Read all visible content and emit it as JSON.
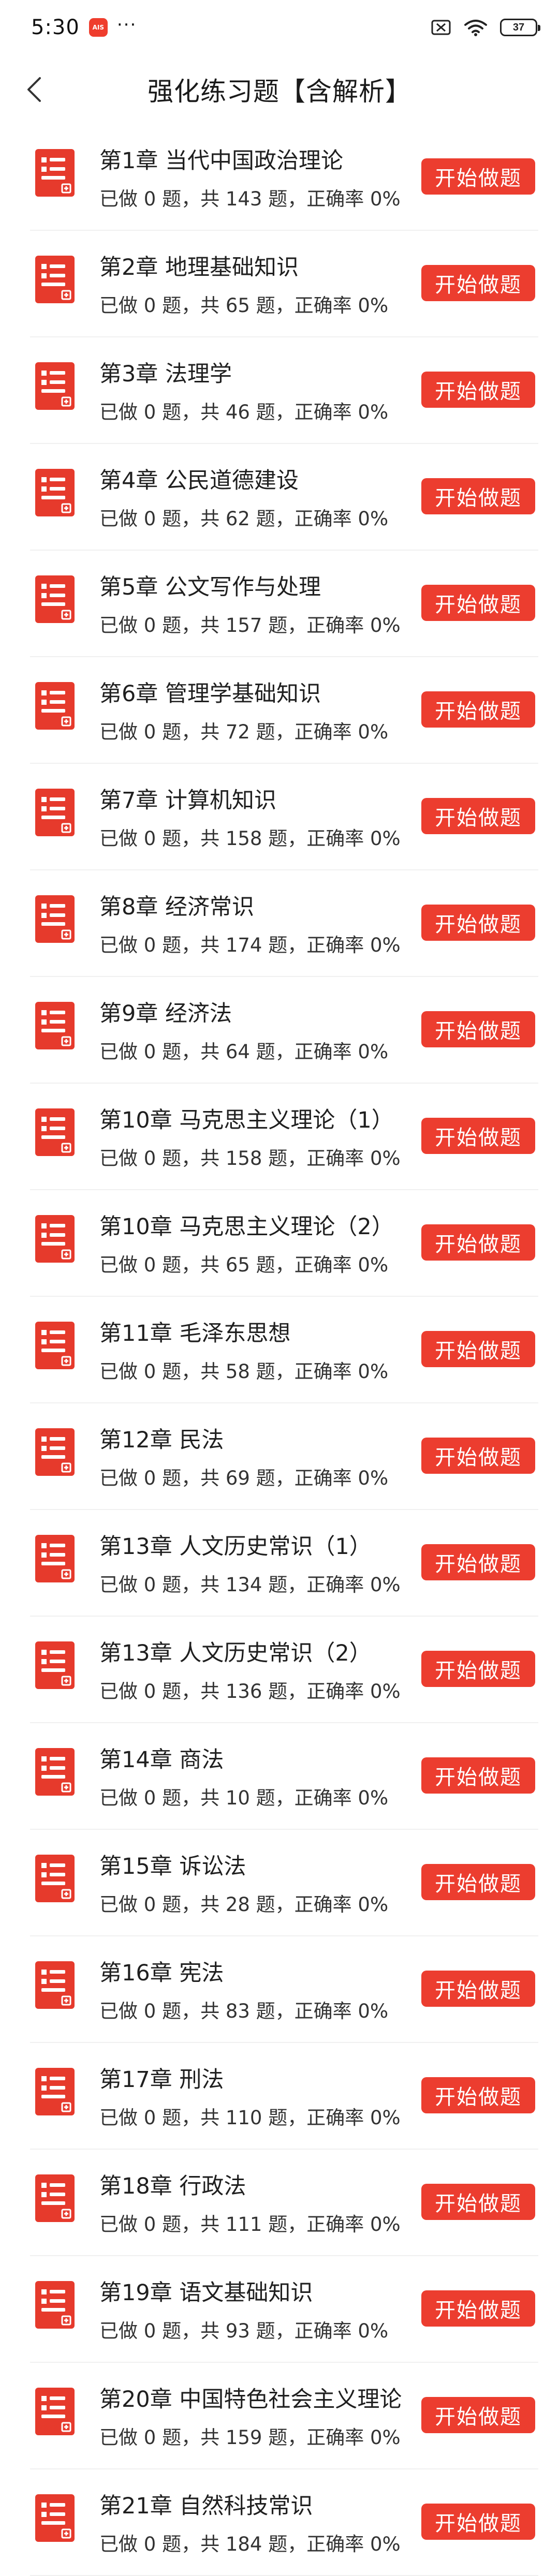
{
  "status_bar": {
    "time": "5:30",
    "app_badge": "AIS",
    "more": "···",
    "battery": "37"
  },
  "header": {
    "title": "强化练习题【含解析】"
  },
  "colors": {
    "accent": "#ec3d2f",
    "divider": "#f0f0f0"
  },
  "chapter_button_label": "开始做题",
  "chapters": [
    {
      "title": "第1章 当代中国政治理论",
      "stats": "已做 0 题，共 143 题，正确率 0%"
    },
    {
      "title": "第2章 地理基础知识",
      "stats": "已做 0 题，共 65 题，正确率 0%"
    },
    {
      "title": "第3章 法理学",
      "stats": "已做 0 题，共 46 题，正确率 0%"
    },
    {
      "title": "第4章 公民道德建设",
      "stats": "已做 0 题，共 62 题，正确率 0%"
    },
    {
      "title": "第5章 公文写作与处理",
      "stats": "已做 0 题，共 157 题，正确率 0%"
    },
    {
      "title": "第6章 管理学基础知识",
      "stats": "已做 0 题，共 72 题，正确率 0%"
    },
    {
      "title": "第7章 计算机知识",
      "stats": "已做 0 题，共 158 题，正确率 0%"
    },
    {
      "title": "第8章 经济常识",
      "stats": "已做 0 题，共 174 题，正确率 0%"
    },
    {
      "title": "第9章 经济法",
      "stats": "已做 0 题，共 64 题，正确率 0%"
    },
    {
      "title": "第10章 马克思主义理论（1）",
      "stats": "已做 0 题，共 158 题，正确率 0%"
    },
    {
      "title": "第10章 马克思主义理论（2）",
      "stats": "已做 0 题，共 65 题，正确率 0%"
    },
    {
      "title": "第11章 毛泽东思想",
      "stats": "已做 0 题，共 58 题，正确率 0%"
    },
    {
      "title": "第12章 民法",
      "stats": "已做 0 题，共 69 题，正确率 0%"
    },
    {
      "title": "第13章 人文历史常识（1）",
      "stats": "已做 0 题，共 134 题，正确率 0%"
    },
    {
      "title": "第13章 人文历史常识（2）",
      "stats": "已做 0 题，共 136 题，正确率 0%"
    },
    {
      "title": "第14章 商法",
      "stats": "已做 0 题，共 10 题，正确率 0%"
    },
    {
      "title": "第15章 诉讼法",
      "stats": "已做 0 题，共 28 题，正确率 0%"
    },
    {
      "title": "第16章 宪法",
      "stats": "已做 0 题，共 83 题，正确率 0%"
    },
    {
      "title": "第17章 刑法",
      "stats": "已做 0 题，共 110 题，正确率 0%"
    },
    {
      "title": "第18章 行政法",
      "stats": "已做 0 题，共 111 题，正确率 0%"
    },
    {
      "title": "第19章 语文基础知识",
      "stats": "已做 0 题，共 93 题，正确率 0%"
    },
    {
      "title": "第20章 中国特色社会主义理论",
      "stats": "已做 0 题，共 159 题，正确率 0%"
    },
    {
      "title": "第21章 自然科技常识",
      "stats": "已做 0 题，共 184 题，正确率 0%"
    }
  ]
}
